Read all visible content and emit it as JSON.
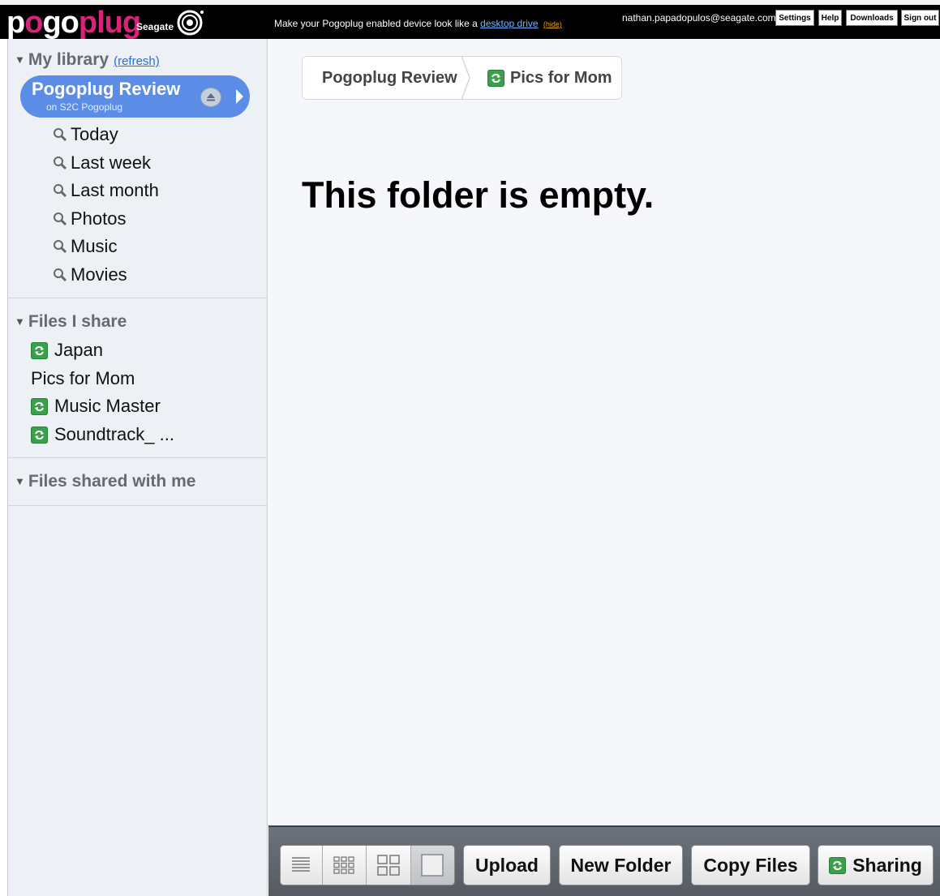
{
  "header": {
    "logo_white_1": "p",
    "logo_magenta_o": "o",
    "logo_white_2": "go",
    "logo_magenta_2": "plug",
    "brand": "Seagate",
    "promo_prefix": "Make your Pogoplug enabled device look like a",
    "promo_link": "desktop drive",
    "promo_hide": "(hide)",
    "account_email": "nathan.papadopulos@seagate.com",
    "buttons": [
      "Settings",
      "Help",
      "Downloads",
      "Sign out"
    ]
  },
  "sidebar": {
    "library": {
      "title": "My library",
      "refresh": "(refresh)",
      "device_name": "Pogoplug Review",
      "device_sub": "on S2C Pogoplug",
      "searches": [
        "Today",
        "Last week",
        "Last month",
        "Photos",
        "Music",
        "Movies"
      ]
    },
    "files_i_share": {
      "title": "Files I share",
      "items": [
        {
          "label": "Japan",
          "shared": true
        },
        {
          "label": "Pics for Mom",
          "shared": false
        },
        {
          "label": "Music Master",
          "shared": true
        },
        {
          "label": "Soundtrack_ ...",
          "shared": true
        }
      ]
    },
    "files_shared_with_me": {
      "title": "Files shared with me"
    }
  },
  "main": {
    "breadcrumbs": [
      "Pogoplug Review",
      "Pics for Mom"
    ],
    "empty_message": "This folder is empty."
  },
  "toolbar": {
    "view_modes": [
      "list-view-icon",
      "small-grid-view-icon",
      "large-grid-view-icon",
      "single-view-icon"
    ],
    "active_view": 3,
    "upload": "Upload",
    "new_folder": "New Folder",
    "copy_files": "Copy Files",
    "sharing": "Sharing"
  },
  "colors": {
    "accent_blue": "#5b8de6",
    "logo_magenta": "#d6247a",
    "share_green": "#3aa04c",
    "link_blue": "#2a6fd4"
  }
}
